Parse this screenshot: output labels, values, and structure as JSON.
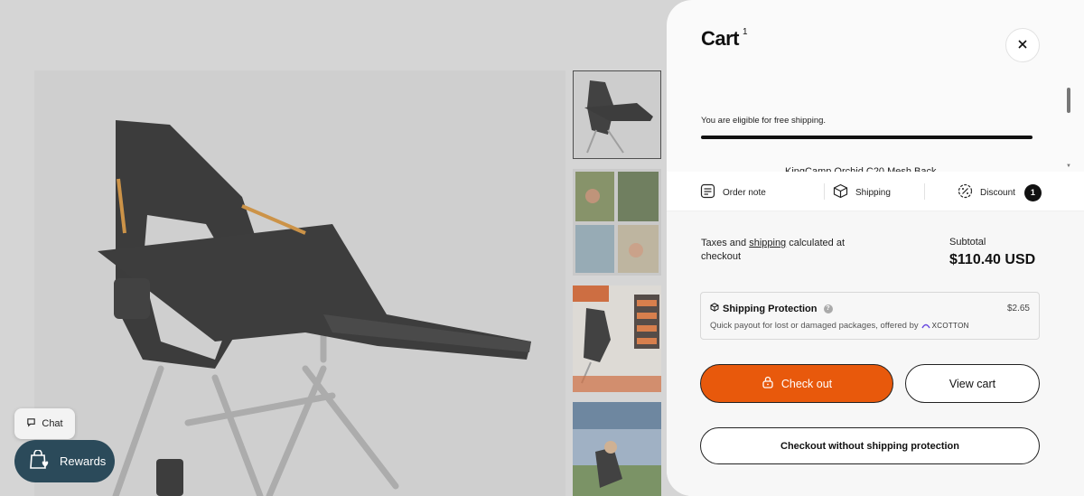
{
  "floating": {
    "chat_label": "Chat",
    "rewards_label": "Rewards"
  },
  "cart": {
    "title": "Cart",
    "count": "1",
    "free_shipping_msg": "You are eligible for free shipping.",
    "free_shipping_progress": 1.0,
    "product_name_partial": "KingCamp Orchid C20 Mesh Back",
    "actions": {
      "order_note": "Order note",
      "shipping": "Shipping",
      "discount": "Discount",
      "discount_count": "1"
    },
    "footer": {
      "taxes_prefix": "Taxes and ",
      "taxes_link": "shipping",
      "taxes_suffix": " calculated at checkout",
      "subtotal_label": "Subtotal",
      "subtotal_value": "$110.40 USD"
    },
    "protection": {
      "title": "Shipping Protection",
      "price": "$2.65",
      "description": "Quick payout for lost or damaged packages, offered by",
      "provider": "XCOTTON"
    },
    "buttons": {
      "checkout": "Check out",
      "view_cart": "View cart",
      "checkout_no_protection": "Checkout without shipping protection"
    }
  },
  "colors": {
    "checkout_orange": "#e8590c",
    "rewards_teal": "#2b4a5a"
  },
  "icons": [
    "chat-icon",
    "rewards-bag-icon",
    "close-icon",
    "order-note-icon",
    "shipping-box-icon",
    "discount-icon",
    "shield-box-icon",
    "help-icon",
    "lock-icon"
  ]
}
